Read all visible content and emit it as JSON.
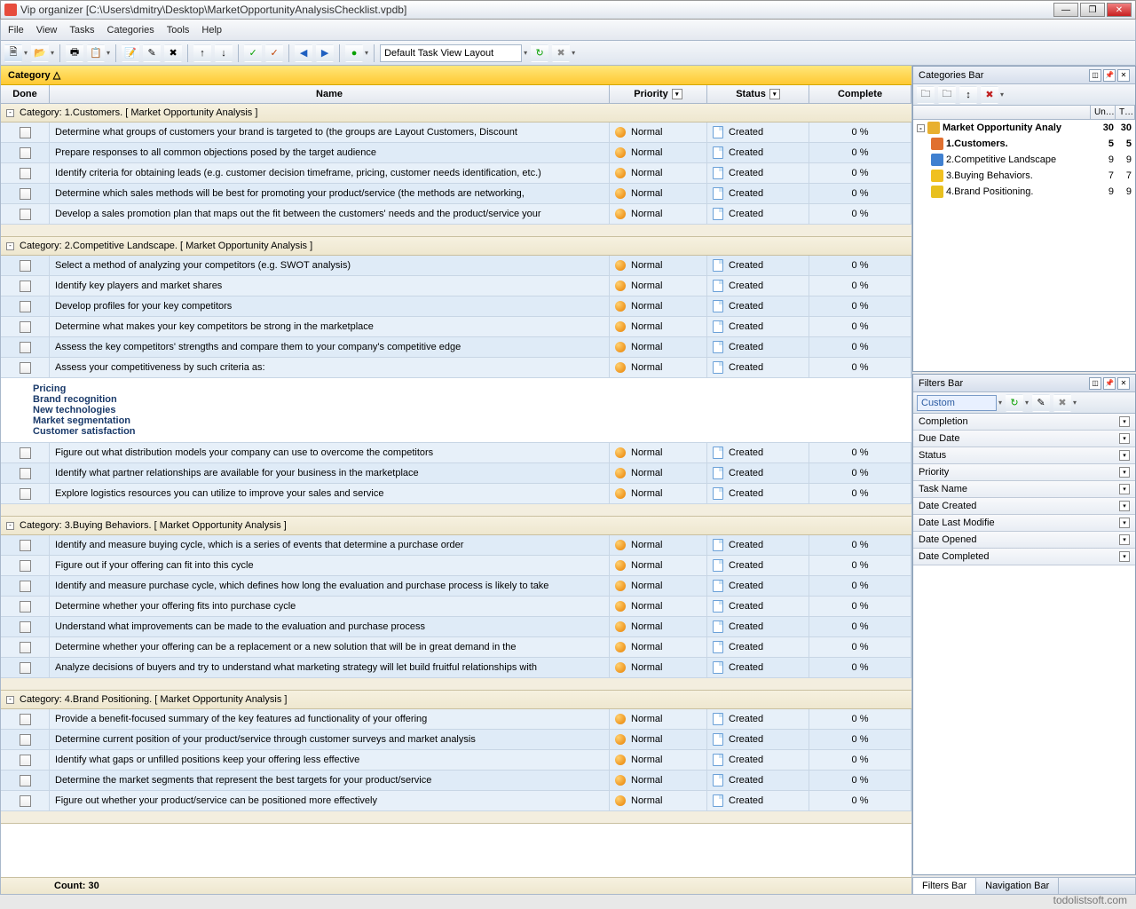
{
  "title": "Vip organizer [C:\\Users\\dmitry\\Desktop\\MarketOpportunityAnalysisChecklist.vpdb]",
  "menu": [
    "File",
    "View",
    "Tasks",
    "Categories",
    "Tools",
    "Help"
  ],
  "layout_input": "Default Task View Layout",
  "group_bar": "Category △",
  "columns": {
    "done": "Done",
    "name": "Name",
    "priority": "Priority",
    "status": "Status",
    "complete": "Complete"
  },
  "footer": "Count:  30",
  "watermark": "todolistsoft.com",
  "categories_panel": {
    "title": "Categories Bar",
    "head_cols": [
      "Un…",
      "T…"
    ],
    "tree": [
      {
        "exp": "-",
        "label": "Market Opportunity Analy",
        "c1": "30",
        "c2": "30",
        "bold": true,
        "indent": 0,
        "iconColor": "#e8b030"
      },
      {
        "label": "1.Customers.",
        "c1": "5",
        "c2": "5",
        "bold": true,
        "indent": 1,
        "iconColor": "#e07030"
      },
      {
        "label": "2.Competitive Landscape",
        "c1": "9",
        "c2": "9",
        "bold": false,
        "indent": 1,
        "iconColor": "#4080d0"
      },
      {
        "label": "3.Buying Behaviors.",
        "c1": "7",
        "c2": "7",
        "bold": false,
        "indent": 1,
        "iconColor": "#f0c020"
      },
      {
        "label": "4.Brand Positioning.",
        "c1": "9",
        "c2": "9",
        "bold": false,
        "indent": 1,
        "iconColor": "#e8c020"
      }
    ]
  },
  "filters_panel": {
    "title": "Filters Bar",
    "input": "Custom",
    "rows": [
      "Completion",
      "Due Date",
      "Status",
      "Priority",
      "Task Name",
      "Date Created",
      "Date Last Modifie",
      "Date Opened",
      "Date Completed"
    ]
  },
  "side_tabs": [
    "Filters Bar",
    "Navigation Bar"
  ],
  "priority_text": "Normal",
  "status_text": "Created",
  "complete_text": "0 %",
  "groups": [
    {
      "header": "Category: 1.Customers.    [ Market Opportunity Analysis ]",
      "tasks": [
        "Determine what groups of customers your brand is targeted to (the groups are Layout Customers, Discount",
        "Prepare responses to all common objections posed by the target audience",
        "Identify criteria for obtaining leads (e.g. customer decision timeframe, pricing, customer needs identification, etc.)",
        "Determine which sales methods will be best for promoting your product/service (the methods are networking,",
        "Develop a sales promotion plan that maps out the fit between the customers' needs and the product/service your"
      ]
    },
    {
      "header": "Category: 2.Competitive Landscape.    [ Market Opportunity Analysis ]",
      "tasks": [
        "Select a method of analyzing your competitors (e.g. SWOT analysis)",
        "Identify key players and market shares",
        "Develop profiles for your key competitors",
        "Determine what makes your key competitors be strong in the marketplace",
        "Assess the key competitors' strengths and compare them to your company's competitive edge",
        "Assess your competitiveness by such criteria as:"
      ],
      "notes": [
        "Pricing",
        "Brand recognition",
        "New technologies",
        "Market segmentation",
        "Customer satisfaction"
      ],
      "tasks_after": [
        "Figure out what distribution models your company can use to overcome the competitors",
        "Identify what partner relationships are available for your business in the marketplace",
        "Explore logistics resources you can utilize to improve your sales and service"
      ]
    },
    {
      "header": "Category: 3.Buying Behaviors.    [ Market Opportunity Analysis ]",
      "tasks": [
        "Identify and measure buying cycle, which is a series of events that determine a purchase order",
        "Figure out if your offering can fit into this cycle",
        "Identify and measure purchase cycle, which defines how long the evaluation and purchase process is likely to take",
        "Determine whether your offering fits into purchase cycle",
        "Understand what improvements can be made to the evaluation and purchase process",
        "Determine whether your offering can be a replacement or a new solution that will be in great demand in the",
        "Analyze decisions of buyers and try to understand what marketing strategy will let build  fruitful relationships with"
      ]
    },
    {
      "header": "Category: 4.Brand Positioning.    [ Market Opportunity Analysis ]",
      "tasks": [
        "Provide a benefit-focused summary of the key features ad functionality of your offering",
        "Determine current position of your product/service through customer surveys and market analysis",
        "Identify what gaps or unfilled positions keep your offering less effective",
        "Determine the market segments that represent the best targets for your product/service",
        "Figure out whether your product/service can be positioned more effectively"
      ]
    }
  ]
}
